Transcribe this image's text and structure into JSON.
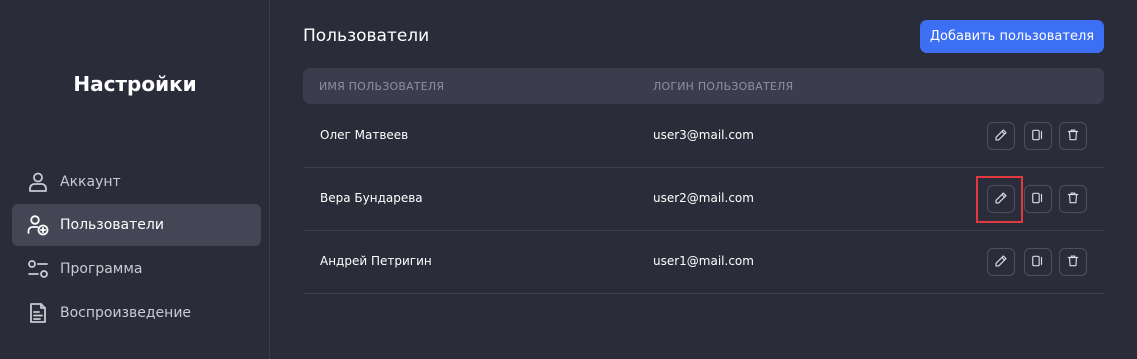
{
  "sidebar": {
    "title": "Настройки",
    "items": [
      {
        "label": "Аккаунт",
        "icon": "user-icon",
        "active": false
      },
      {
        "label": "Пользователи",
        "icon": "user-add-icon",
        "active": true
      },
      {
        "label": "Программа",
        "icon": "settings-sliders-icon",
        "active": false
      },
      {
        "label": "Воспроизведение",
        "icon": "document-icon",
        "active": false
      }
    ]
  },
  "main": {
    "title": "Пользователи",
    "add_button_label": "Добавить пользователя",
    "table": {
      "columns": [
        "ИМЯ ПОЛЬЗОВАТЕЛЯ",
        "ЛОГИН ПОЛЬЗОВАТЕЛЯ"
      ],
      "rows": [
        {
          "name": "Олег Матвеев",
          "login": "user3@mail.com"
        },
        {
          "name": "Вера Бундарева",
          "login": "user2@mail.com"
        },
        {
          "name": "Андрей Петригин",
          "login": "user1@mail.com"
        }
      ],
      "row_actions": [
        "pencil-icon",
        "copy-icon",
        "trash-icon"
      ]
    }
  },
  "colors": {
    "background": "#2b2c39",
    "accent": "#3d6ff5",
    "highlight": "#e0393e"
  }
}
